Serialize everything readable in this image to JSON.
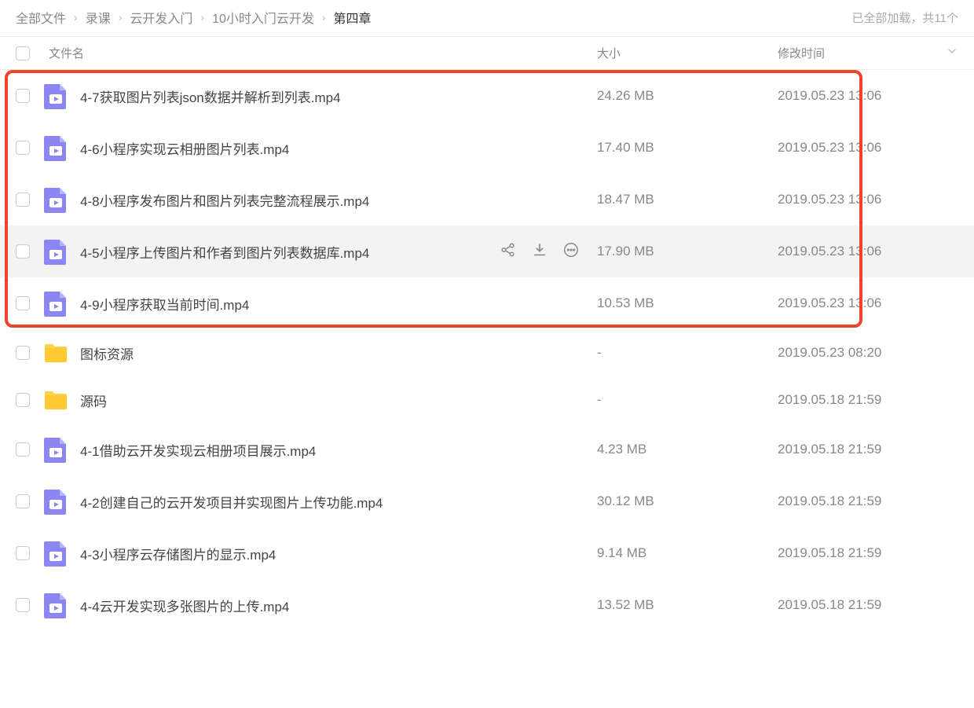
{
  "breadcrumb": {
    "items": [
      {
        "label": "全部文件"
      },
      {
        "label": "录课"
      },
      {
        "label": "云开发入门"
      },
      {
        "label": "10小时入门云开发"
      }
    ],
    "current": "第四章"
  },
  "status_text": "已全部加载，共11个",
  "headers": {
    "name": "文件名",
    "size": "大小",
    "time": "修改时间"
  },
  "files": [
    {
      "type": "video",
      "name": "4-7获取图片列表json数据并解析到列表.mp4",
      "size": "24.26 MB",
      "time": "2019.05.23 13:06",
      "hovered": false
    },
    {
      "type": "video",
      "name": "4-6小程序实现云相册图片列表.mp4",
      "size": "17.40 MB",
      "time": "2019.05.23 13:06",
      "hovered": false
    },
    {
      "type": "video",
      "name": "4-8小程序发布图片和图片列表完整流程展示.mp4",
      "size": "18.47 MB",
      "time": "2019.05.23 13:06",
      "hovered": false
    },
    {
      "type": "video",
      "name": "4-5小程序上传图片和作者到图片列表数据库.mp4",
      "size": "17.90 MB",
      "time": "2019.05.23 13:06",
      "hovered": true
    },
    {
      "type": "video",
      "name": "4-9小程序获取当前时间.mp4",
      "size": "10.53 MB",
      "time": "2019.05.23 13:06",
      "hovered": false
    },
    {
      "type": "folder",
      "name": "图标资源",
      "size": "-",
      "time": "2019.05.23 08:20",
      "hovered": false
    },
    {
      "type": "folder",
      "name": "源码",
      "size": "-",
      "time": "2019.05.18 21:59",
      "hovered": false
    },
    {
      "type": "video",
      "name": "4-1借助云开发实现云相册项目展示.mp4",
      "size": "4.23 MB",
      "time": "2019.05.18 21:59",
      "hovered": false
    },
    {
      "type": "video",
      "name": "4-2创建自己的云开发项目并实现图片上传功能.mp4",
      "size": "30.12 MB",
      "time": "2019.05.18 21:59",
      "hovered": false
    },
    {
      "type": "video",
      "name": "4-3小程序云存储图片的显示.mp4",
      "size": "9.14 MB",
      "time": "2019.05.18 21:59",
      "hovered": false
    },
    {
      "type": "video",
      "name": "4-4云开发实现多张图片的上传.mp4",
      "size": "13.52 MB",
      "time": "2019.05.18 21:59",
      "hovered": false
    }
  ]
}
